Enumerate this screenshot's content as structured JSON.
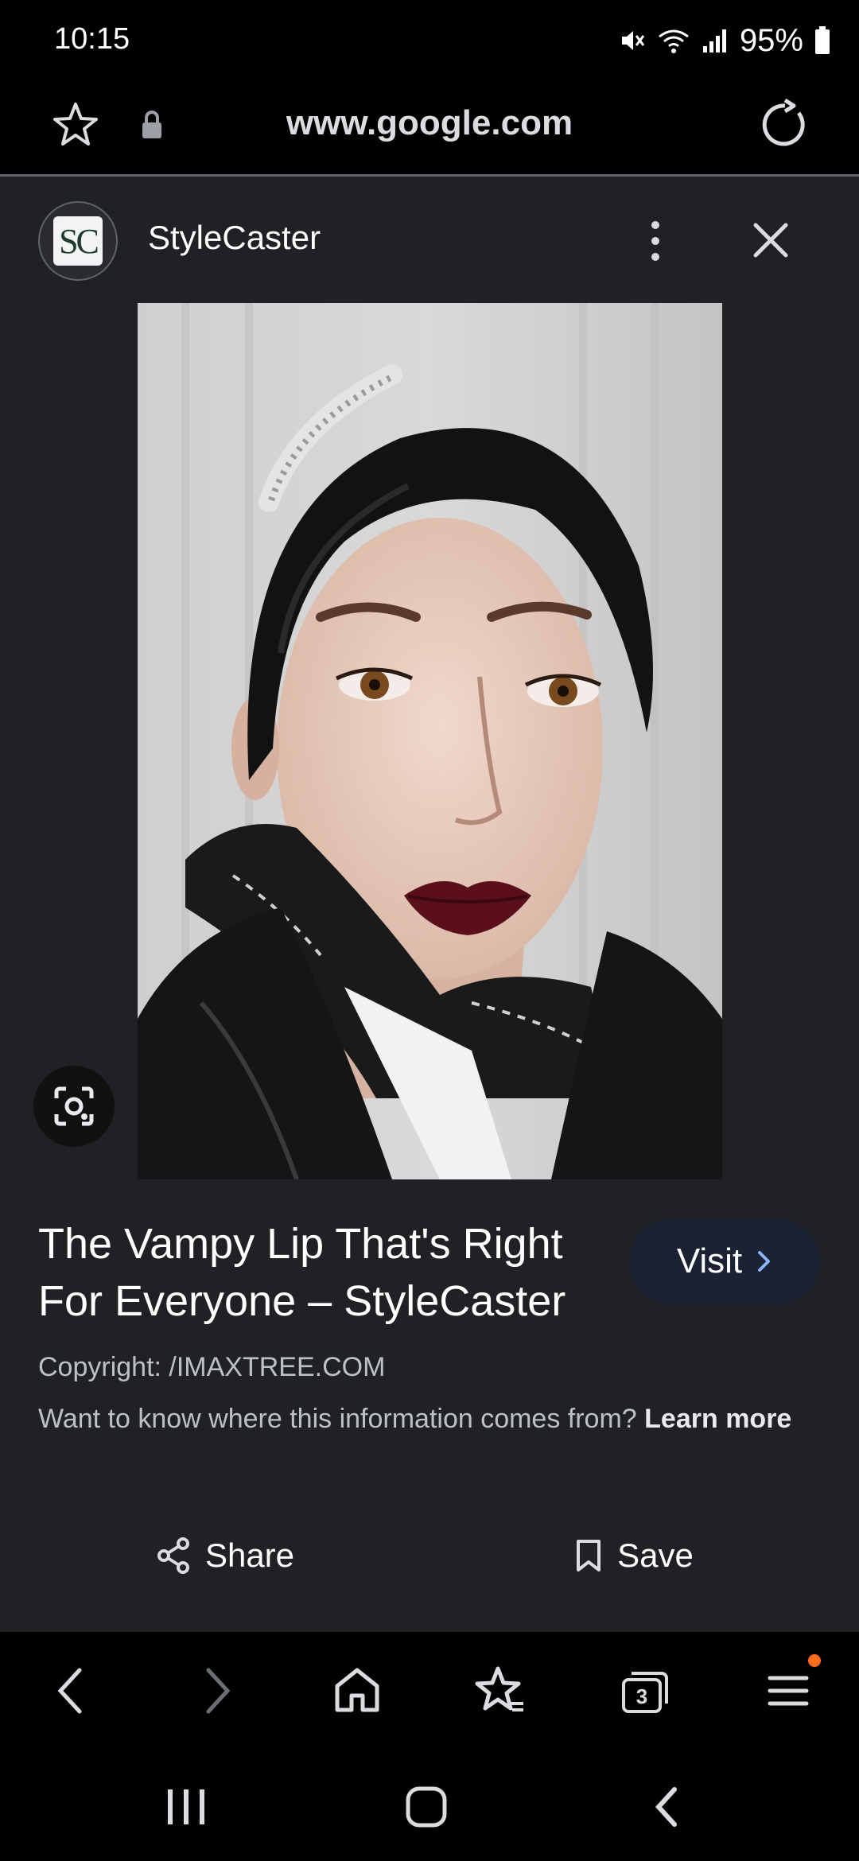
{
  "status_bar": {
    "time": "10:15",
    "battery": "95%"
  },
  "url_bar": {
    "url": "www.google.com"
  },
  "panel": {
    "source_logo_text": "SC",
    "source_name": "StyleCaster"
  },
  "result": {
    "title": "The Vampy Lip That's Right For Everyone – StyleCaster",
    "visit_label": "Visit",
    "copyright": "Copyright: /IMAXTREE.COM",
    "info_text": "Want to know where this information comes from?",
    "learn_more": "Learn more"
  },
  "actions": {
    "share_label": "Share",
    "save_label": "Save"
  },
  "browser_nav": {
    "tabs_count": "3"
  },
  "colors": {
    "background": "#202124",
    "visit_button": "#1a2233",
    "menu_badge": "#ff6d1f",
    "lip": "#5a0f1a"
  }
}
